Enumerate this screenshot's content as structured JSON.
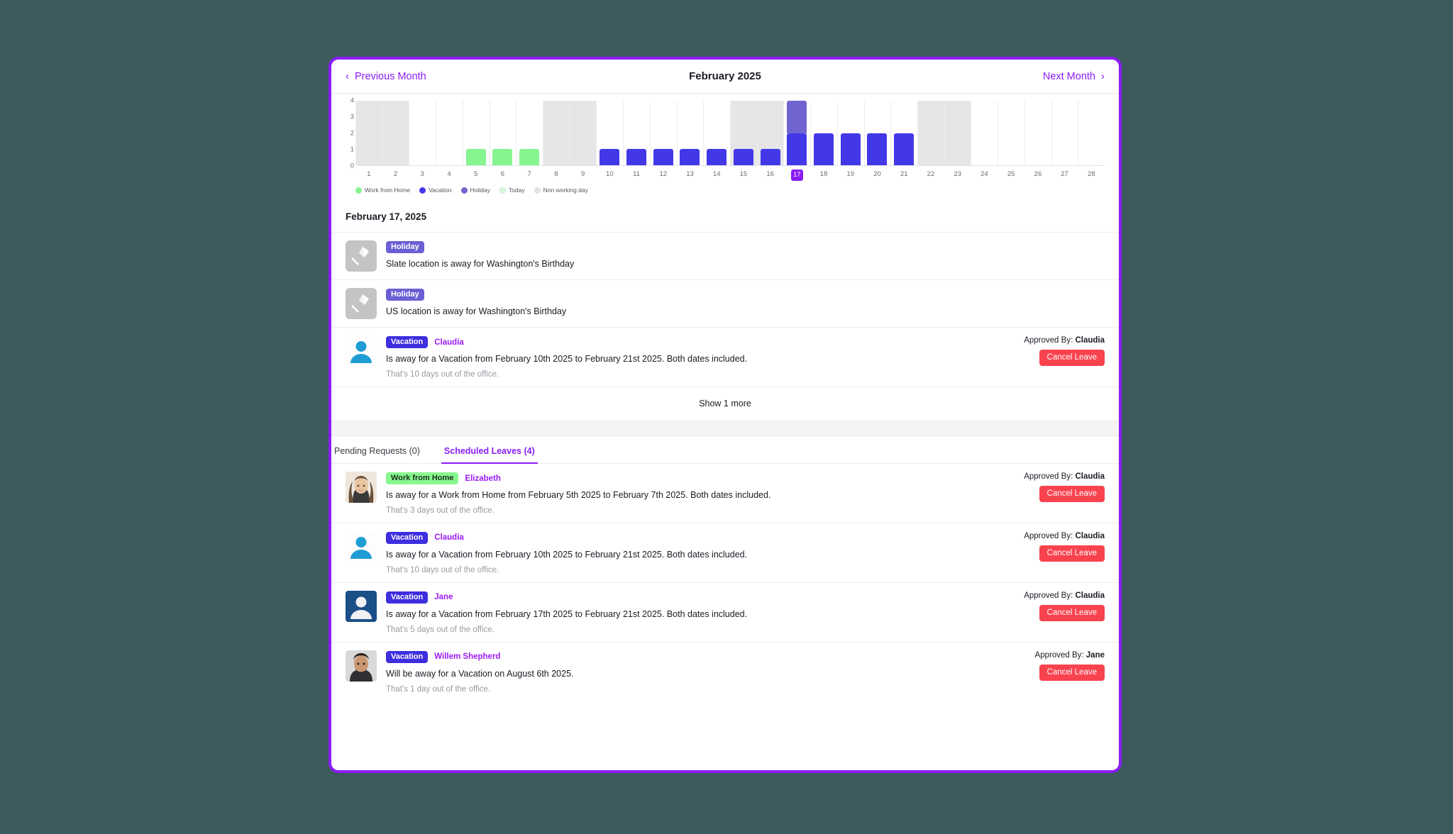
{
  "header": {
    "prev_label": "Previous Month",
    "next_label": "Next Month",
    "month_title": "February 2025",
    "prev_icon": "chevron-left-icon",
    "next_icon": "chevron-right-icon"
  },
  "colors": {
    "brand_purple": "#8a1cf5",
    "wfh_green": "#86f58f",
    "vacation_blue": "#4338e8",
    "holiday_purple": "#7065d0",
    "nonworking_gray": "#e6e6e6",
    "cancel_red": "#f8434f",
    "person_name_purple": "#9b1bf0"
  },
  "chart_data": {
    "type": "bar",
    "title": "February 2025",
    "xlabel": "",
    "ylabel": "",
    "ylim": [
      0,
      4
    ],
    "yticks": [
      0,
      1,
      2,
      3,
      4
    ],
    "grid": false,
    "stacked": true,
    "legend_position": "bottom-left",
    "categories": [
      1,
      2,
      3,
      4,
      5,
      6,
      7,
      8,
      9,
      10,
      11,
      12,
      13,
      14,
      15,
      16,
      17,
      18,
      19,
      20,
      21,
      22,
      23,
      24,
      25,
      26,
      27,
      28
    ],
    "series": [
      {
        "name": "Work from Home",
        "color": "#86f58f",
        "values": [
          0,
          0,
          0,
          0,
          1,
          1,
          1,
          0,
          0,
          0,
          0,
          0,
          0,
          0,
          0,
          0,
          0,
          0,
          0,
          0,
          0,
          0,
          0,
          0,
          0,
          0,
          0,
          0
        ]
      },
      {
        "name": "Vacation",
        "color": "#4338e8",
        "values": [
          0,
          0,
          0,
          0,
          0,
          0,
          0,
          0,
          0,
          1,
          1,
          1,
          1,
          1,
          1,
          1,
          2,
          2,
          2,
          2,
          2,
          0,
          0,
          0,
          0,
          0,
          0,
          0
        ]
      },
      {
        "name": "Holiday",
        "color": "#7065d0",
        "values": [
          0,
          0,
          0,
          0,
          0,
          0,
          0,
          0,
          0,
          0,
          0,
          0,
          0,
          0,
          0,
          0,
          2,
          0,
          0,
          0,
          0,
          0,
          0,
          0,
          0,
          0,
          0,
          0
        ]
      }
    ],
    "non_working_days": [
      1,
      2,
      8,
      9,
      15,
      16,
      22,
      23
    ],
    "today": 17,
    "legend": [
      {
        "label": "Work from Home",
        "color": "#86f58f"
      },
      {
        "label": "Vacation",
        "color": "#4338e8"
      },
      {
        "label": "Holiday",
        "color": "#7065d0"
      },
      {
        "label": "Today",
        "color": "#d8f8dc"
      },
      {
        "label": "Non working day",
        "color": "#e6e6e6"
      }
    ]
  },
  "day_detail": {
    "title": "February 17, 2025",
    "show_more_label": "Show 1 more",
    "events": [
      {
        "icon": "kite-icon",
        "icon_kind": "holiday",
        "badge": "Holiday",
        "badge_kind": "holiday",
        "person": "",
        "description": "Slate location is away for Washington's Birthday",
        "sub": "",
        "approved_prefix": "",
        "approved_by": "",
        "cancel_label": ""
      },
      {
        "icon": "kite-icon",
        "icon_kind": "holiday",
        "badge": "Holiday",
        "badge_kind": "holiday",
        "person": "",
        "description": "US location is away for Washington's Birthday",
        "sub": "",
        "approved_prefix": "",
        "approved_by": "",
        "cancel_label": ""
      },
      {
        "icon": "avatar-person-light-blue",
        "icon_kind": "avatar-claudia",
        "badge": "Vacation",
        "badge_kind": "vacation",
        "person": "Claudia",
        "description": "Is away for a Vacation from February 10th 2025 to February 21st 2025. Both dates included.",
        "sub": "That's 10 days out of the office.",
        "approved_prefix": "Approved By:",
        "approved_by": "Claudia",
        "cancel_label": "Cancel Leave"
      }
    ]
  },
  "tabs": [
    {
      "label": "Pending Requests (0)",
      "active": false
    },
    {
      "label": "Scheduled Leaves (4)",
      "active": true
    }
  ],
  "scheduled_leaves": [
    {
      "icon_kind": "avatar-elizabeth",
      "badge": "Work from Home",
      "badge_kind": "wfh",
      "person": "Elizabeth",
      "description": "Is away for a Work from Home from February 5th 2025 to February 7th 2025. Both dates included.",
      "sub": "That's 3 days out of the office.",
      "approved_prefix": "Approved By:",
      "approved_by": "Claudia",
      "cancel_label": "Cancel Leave"
    },
    {
      "icon_kind": "avatar-claudia",
      "badge": "Vacation",
      "badge_kind": "vacation",
      "person": "Claudia",
      "description": "Is away for a Vacation from February 10th 2025 to February 21st 2025. Both dates included.",
      "sub": "That's 10 days out of the office.",
      "approved_prefix": "Approved By:",
      "approved_by": "Claudia",
      "cancel_label": "Cancel Leave"
    },
    {
      "icon_kind": "avatar-jane",
      "badge": "Vacation",
      "badge_kind": "vacation",
      "person": "Jane",
      "description": "Is away for a Vacation from February 17th 2025 to February 21st 2025. Both dates included.",
      "sub": "That's 5 days out of the office.",
      "approved_prefix": "Approved By:",
      "approved_by": "Claudia",
      "cancel_label": "Cancel Leave"
    },
    {
      "icon_kind": "avatar-willem",
      "badge": "Vacation",
      "badge_kind": "vacation",
      "person": "Willem Shepherd",
      "description": "Will be away for a Vacation on August 6th 2025.",
      "sub": "That's 1 day out of the office.",
      "approved_prefix": "Approved By:",
      "approved_by": "Jane",
      "cancel_label": "Cancel Leave"
    }
  ]
}
